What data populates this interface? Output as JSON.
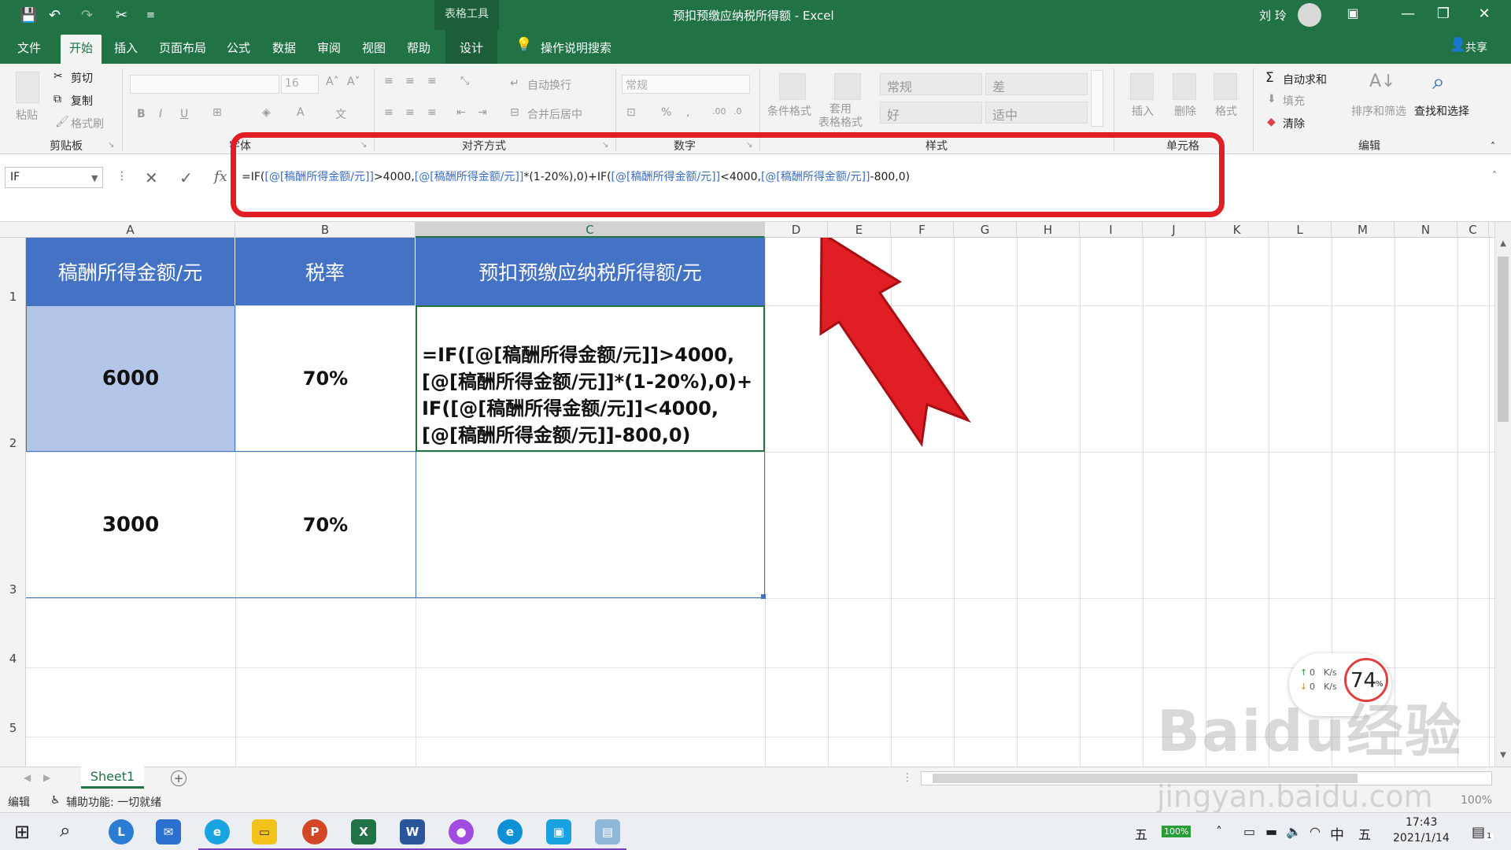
{
  "title_bar": {
    "save": "💾",
    "undo": "↶",
    "redo": "↷",
    "cut": "✂",
    "more": "≡",
    "context": "表格工具",
    "title": "预扣预缴应纳税所得额 - Excel",
    "user": "刘 玲",
    "ribbon_opt": "▣",
    "minimize": "—",
    "restore": "❐",
    "close": "✕"
  },
  "tabs": [
    "文件",
    "开始",
    "插入",
    "页面布局",
    "公式",
    "数据",
    "审阅",
    "视图",
    "帮助"
  ],
  "design_tab": "设计",
  "tell_me": "操作说明搜索",
  "share": "共享",
  "ribbon": {
    "paste": "粘贴",
    "cut": "剪切",
    "copy": "复制",
    "format_painter": "格式刷",
    "clipboard": "剪贴板",
    "font_size": "16",
    "bold": "B",
    "italic": "I",
    "underline": "U",
    "font_group": "字体",
    "wrap": "自动换行",
    "merge": "合并后居中",
    "align_group": "对齐方式",
    "number_format": "常规",
    "percent": "%",
    "comma": ",",
    "number_group": "数字",
    "cond_format": "条件格式",
    "table_format": "套用\n表格格式",
    "style_normal": "常规",
    "style_bad": "差",
    "style_good": "好",
    "style_neutral": "适中",
    "styles_group": "样式",
    "insert": "插入",
    "delete": "删除",
    "format": "格式",
    "cells_group": "单元格",
    "autosum": "自动求和",
    "fill": "填充",
    "clear": "清除",
    "sort": "排序和筛选",
    "find": "查找和选择",
    "edit_group": "编辑"
  },
  "formula_bar": {
    "name_box": "IF",
    "cancel": "✕",
    "enter": "✓",
    "fx": "fx",
    "parts": [
      {
        "t": "=IF(",
        "ref": false
      },
      {
        "t": "[@[稿酬所得金额/元]]",
        "ref": true
      },
      {
        "t": ">4000,",
        "ref": false
      },
      {
        "t": "[@[稿酬所得金额/元]]",
        "ref": true
      },
      {
        "t": "*(1-20%),0)+IF(",
        "ref": false
      },
      {
        "t": "[@[稿酬所得金额/元]]",
        "ref": true
      },
      {
        "t": "<4000,",
        "ref": false
      },
      {
        "t": "[@[稿酬所得金额/元]]",
        "ref": true
      },
      {
        "t": "-800,0)",
        "ref": false
      }
    ]
  },
  "columns": [
    "A",
    "B",
    "C",
    "D",
    "E",
    "F",
    "G",
    "H",
    "I",
    "J",
    "K",
    "L",
    "M",
    "N",
    "C"
  ],
  "rows": [
    "1",
    "2",
    "3",
    "4",
    "5"
  ],
  "table": {
    "headers": [
      "稿酬所得金额/元",
      "税率",
      "预扣预缴应纳税所得额/元"
    ],
    "row2": {
      "a": "6000",
      "b": "70%",
      "c_lines": [
        "=IF([@[稿酬所得金额/元]]>4000,",
        "[@[稿酬所得金额/元]]*(1-20%),0)+",
        "IF([@[稿酬所得金额/元]]<4000,",
        "[@[稿酬所得金额/元]]-800,0)"
      ]
    },
    "row3": {
      "a": "3000",
      "b": "70%",
      "c": ""
    }
  },
  "sheet_tab": "Sheet1",
  "add_sheet": "+",
  "status": {
    "mode": "编辑",
    "accessibility": "辅助功能: 一切就绪",
    "zoom": "100%"
  },
  "net_widget": {
    "up": "0",
    "down": "0",
    "unit": "K/s",
    "cpu": "74",
    "cpu_unit": "%"
  },
  "watermark": {
    "main": "Baidu经验",
    "sub": "jingyan.baidu.com"
  },
  "taskbar": {
    "ime1": "五",
    "battery": "100%",
    "ime_lang": "中",
    "ime2": "五",
    "time": "17:43",
    "date": "2021/1/14",
    "notif": "1"
  },
  "colors": {
    "excel_green": "#217346",
    "header_blue": "#4472c4",
    "selected_blue": "#b4c6e7",
    "highlight_red": "#e01e24"
  }
}
